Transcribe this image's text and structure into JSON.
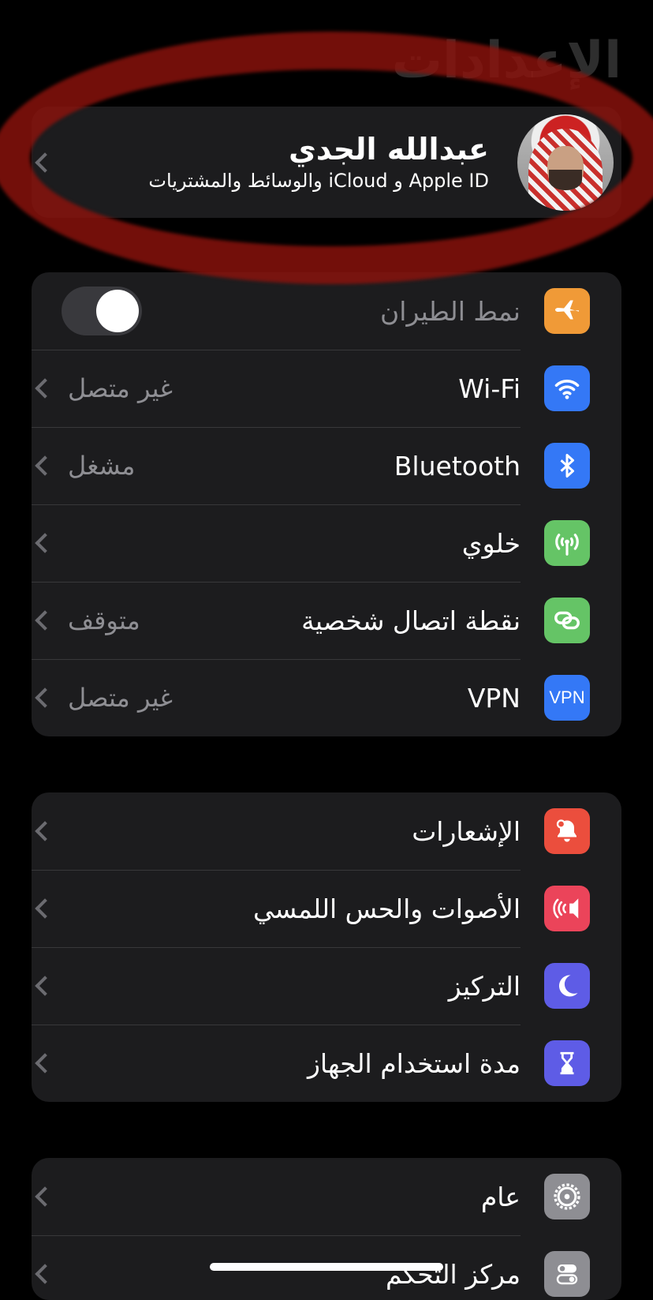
{
  "page": {
    "title": "الإعدادات"
  },
  "profile": {
    "name": "عبدالله الجدي",
    "subtitle": "Apple ID و iCloud والوسائط والمشتريات"
  },
  "connectivity": {
    "airplane": {
      "label": "نمط الطيران",
      "enabled": false,
      "icon": "airplane-icon",
      "color": "#f09a37"
    },
    "wifi": {
      "label": "Wi-Fi",
      "value": "غير متصل",
      "icon": "wifi-icon",
      "color": "#3478f6"
    },
    "bluetooth": {
      "label": "Bluetooth",
      "value": "مشغل",
      "icon": "bluetooth-icon",
      "color": "#3478f6"
    },
    "cellular": {
      "label": "خلوي",
      "icon": "cellular-antenna-icon",
      "color": "#65c466"
    },
    "hotspot": {
      "label": "نقطة اتصال شخصية",
      "value": "متوقف",
      "icon": "hotspot-icon",
      "color": "#65c466"
    },
    "vpn": {
      "label": "VPN",
      "value": "غير متصل",
      "icon_text": "VPN",
      "color": "#3478f6"
    }
  },
  "notifications_group": {
    "notifications": {
      "label": "الإشعارات",
      "icon": "bell-icon",
      "color": "#eb4e3d"
    },
    "sounds": {
      "label": "الأصوات والحس اللمسي",
      "icon": "speaker-icon",
      "color": "#eb445a"
    },
    "focus": {
      "label": "التركيز",
      "icon": "moon-icon",
      "color": "#5e5ce6"
    },
    "screen_time": {
      "label": "مدة استخدام الجهاز",
      "icon": "hourglass-icon",
      "color": "#5e5ce6"
    }
  },
  "general_group": {
    "general": {
      "label": "عام",
      "icon": "gear-icon",
      "color": "#8e8e93"
    },
    "control_center": {
      "label": "مركز التحكم",
      "icon": "switches-icon",
      "color": "#8e8e93"
    }
  }
}
